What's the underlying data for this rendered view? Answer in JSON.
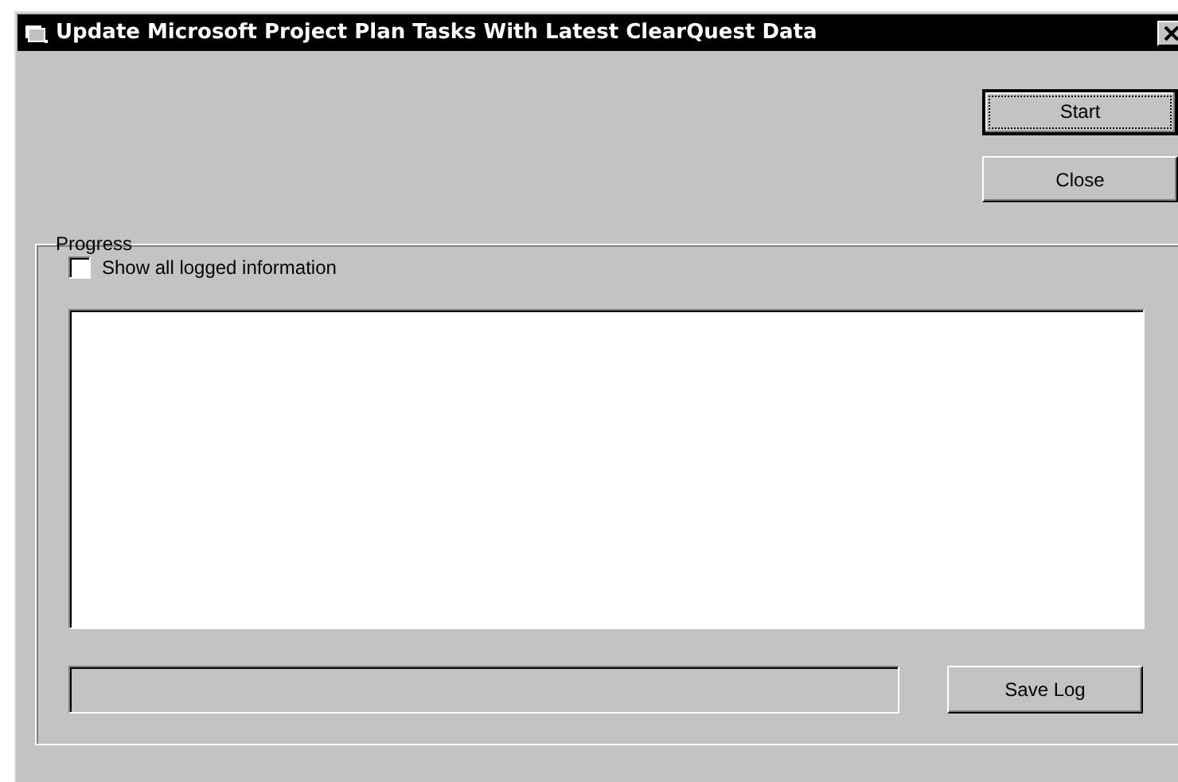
{
  "window": {
    "title": "Update Microsoft Project Plan Tasks With Latest ClearQuest Data"
  },
  "buttons": [
    {
      "label": "Start",
      "focused": true
    },
    {
      "label": "Close",
      "focused": false
    }
  ],
  "progress": {
    "title": "Progress",
    "show_all": {
      "label": "Show all logged information",
      "checked": false
    },
    "save_button": "Save Log"
  }
}
